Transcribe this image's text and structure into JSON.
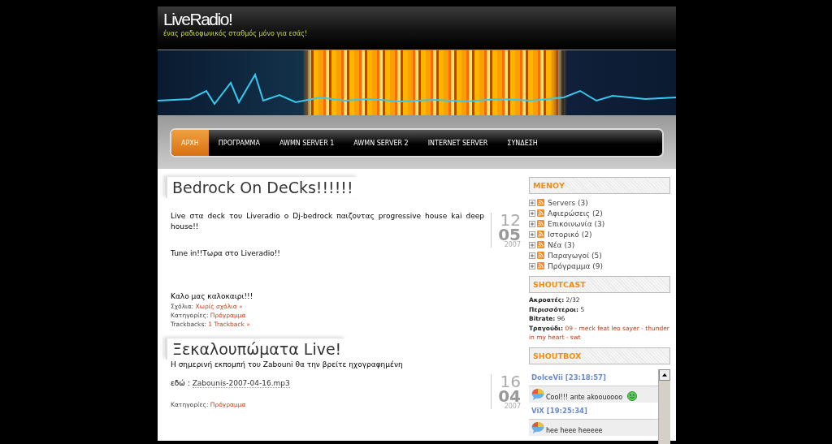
{
  "site": {
    "title": "LiveRadio!",
    "tagline": "ένας ραδιοφωνικός σταθμός μόνο για εσάς!"
  },
  "nav": [
    {
      "label": "ΑΡΧΗ",
      "selected": true
    },
    {
      "label": "ΠΡΟΓΡΑΜΜΑ",
      "selected": false
    },
    {
      "label": "AWMN SERVER 1",
      "selected": false
    },
    {
      "label": "AWMN SERVER 2",
      "selected": false
    },
    {
      "label": "INTERNET SERVER",
      "selected": false
    },
    {
      "label": "ΣΥΝΔΕΣΗ",
      "selected": false
    }
  ],
  "posts": [
    {
      "title": "Bedrock On DeCks!!!!!!",
      "date": {
        "day": "12",
        "month": "05",
        "year": "2007"
      },
      "paragraphs": [
        {
          "kind": "text",
          "text": "Live στα deck του Liveradio ο Dj-bedrock παιζοντας progressive house kai deep house!!"
        },
        {
          "kind": "text",
          "text": "Tune in!!Τωρα στο Liveradio!!"
        },
        {
          "kind": "closing",
          "text": "Καλο μας καλοκαιρι!!!"
        }
      ],
      "meta": [
        {
          "label": "Σχόλια:",
          "link": "Χωρίς σχόλια »"
        },
        {
          "label": "Κατηγορίες:",
          "link": "Πρόγραμμα"
        },
        {
          "label": "Trackbacks:",
          "link": "1 Trackback »"
        }
      ]
    },
    {
      "title": "Ξεκαλουπώματα Live!",
      "date": {
        "day": "16",
        "month": "04",
        "year": "2007"
      },
      "paragraphs": [
        {
          "kind": "text",
          "text": "Η σημερινή εκπομπή του Zabouni θα την βρείτε ηχογραφημένη"
        },
        {
          "kind": "link",
          "text": "εδώ :",
          "link": "Zabounis-2007-04-16.mp3"
        }
      ],
      "meta": [
        {
          "label": "Κατηγορίες:",
          "link": "Πρόγραμμα"
        }
      ]
    }
  ],
  "sidebar": {
    "menu": {
      "title": "ΜΕΝΟΥ",
      "items": [
        {
          "label": "Servers (3)"
        },
        {
          "label": "Αφιερώσεις (2)"
        },
        {
          "label": "Επικοινωνία (3)"
        },
        {
          "label": "Ιστορικό (2)"
        },
        {
          "label": "Νέα (3)"
        },
        {
          "label": "Παραγωγοί (5)"
        },
        {
          "label": "Πρόγραμμα (9)"
        }
      ]
    },
    "shoutcast": {
      "title": "SHOUTCAST",
      "rows": [
        {
          "label": "Ακροατές:",
          "value": "2/32",
          "kind": "plain"
        },
        {
          "label": "Περισσότεροι:",
          "value": "5",
          "kind": "plain"
        },
        {
          "label": "Bitrate:",
          "value": "96",
          "kind": "plain"
        },
        {
          "label": "Τραγούδι:",
          "value": "09 - meck feat leo sayer - thunder in my heart - swt",
          "kind": "link"
        }
      ]
    },
    "shoutbox": {
      "title": "SHOUTBOX",
      "messages": [
        {
          "author": "DolceVii [23:18:57]",
          "text": "Cool!!! ante akoouoooo",
          "smiley": true
        },
        {
          "author": "ViX [19:25:34]",
          "text": "hee heee heeeee",
          "smiley": false
        }
      ]
    }
  }
}
